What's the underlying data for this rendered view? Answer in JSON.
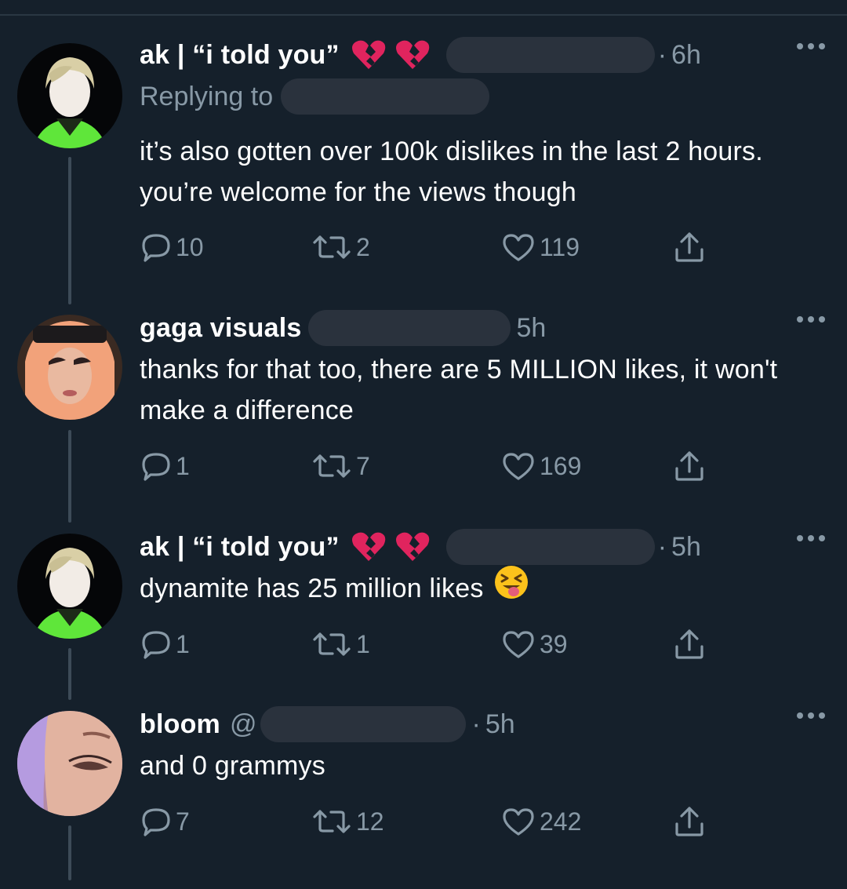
{
  "tweets": [
    {
      "name": "ak | “i told you”",
      "handle_prefix": "",
      "dot": "·",
      "time": "6h",
      "replying_label": "Replying to",
      "text": "it’s also gotten over 100k dislikes in the last 2 hours. you’re welcome for the views though",
      "text_emoji": "",
      "name_emojis": [
        "broken-heart",
        "broken-heart"
      ],
      "replies": "10",
      "retweets": "2",
      "likes": "119"
    },
    {
      "name": "gaga visuals",
      "handle_prefix": "",
      "dot": "",
      "time": "5h",
      "replying_label": "",
      "text": "thanks for that too, there are 5 MILLION likes, it won't make a difference",
      "text_emoji": "",
      "name_emojis": [],
      "replies": "1",
      "retweets": "7",
      "likes": "169"
    },
    {
      "name": "ak | “i told you”",
      "handle_prefix": "",
      "dot": "·",
      "time": "5h",
      "replying_label": "",
      "text": "dynamite has 25 million likes",
      "text_emoji": "squinting-face-with-tongue",
      "name_emojis": [
        "broken-heart",
        "broken-heart"
      ],
      "replies": "1",
      "retweets": "1",
      "likes": "39"
    },
    {
      "name": "bloom",
      "handle_prefix": "@",
      "dot": "·",
      "time": "5h",
      "replying_label": "",
      "text": "and 0 grammys",
      "text_emoji": "",
      "name_emojis": [],
      "replies": "7",
      "retweets": "12",
      "likes": "242"
    }
  ],
  "colors": {
    "background": "#15202b",
    "secondary_text": "#8899a6",
    "primary_text": "#ffffff",
    "thread_line": "#3d4b58",
    "redaction": "#2a323d",
    "broken_heart": "#e0245e"
  },
  "icons": {
    "reply": "reply-bubble-icon",
    "retweet": "retweet-icon",
    "like": "heart-icon",
    "share": "share-icon",
    "more": "more-dots-icon"
  }
}
